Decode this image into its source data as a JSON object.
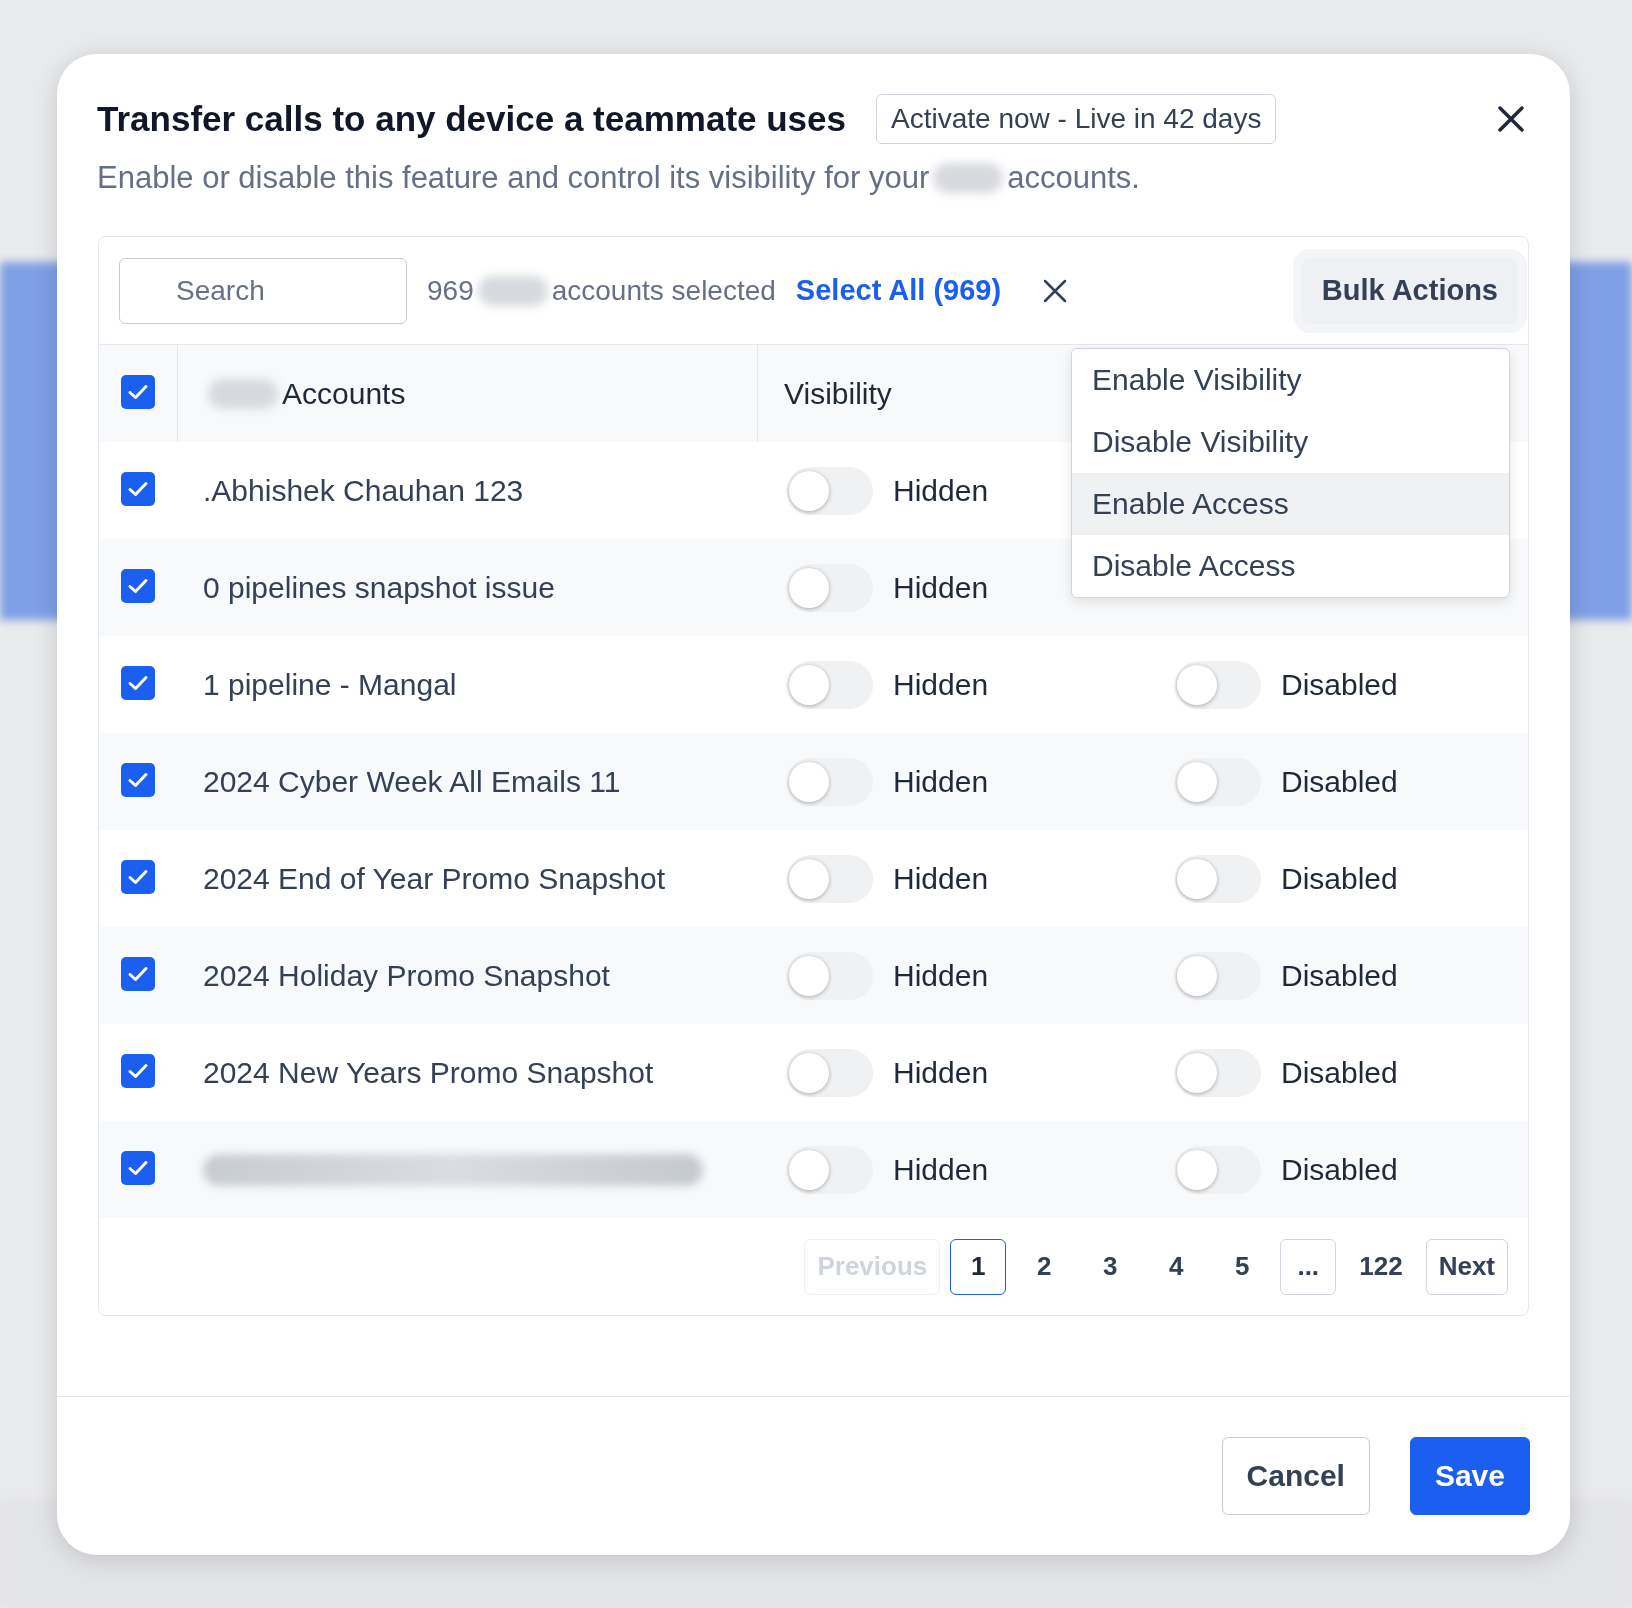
{
  "dialog": {
    "title": "Transfer calls to any device a teammate uses",
    "badge": "Activate now - Live in 42 days",
    "subtitle_before": "Enable or disable this feature and control its visibility for your",
    "subtitle_after": "accounts."
  },
  "toolbar": {
    "search": {
      "placeholder": "Search"
    },
    "count_before": "969",
    "count_after": "accounts selected",
    "select_all": "Select All (969)",
    "bulk_actions": "Bulk Actions"
  },
  "bulk_menu": {
    "open": true,
    "items": [
      {
        "label": "Enable Visibility",
        "highlighted": false
      },
      {
        "label": "Disable Visibility",
        "highlighted": false
      },
      {
        "label": "Enable Access",
        "highlighted": true
      },
      {
        "label": "Disable Access",
        "highlighted": false
      }
    ]
  },
  "table": {
    "all_checked": true,
    "columns": [
      "Accounts",
      "Visibility"
    ],
    "rows": [
      {
        "name": ".Abhishek Chauhan 123",
        "checked": true,
        "visibility": {
          "on": false,
          "label": "Hidden"
        }
      },
      {
        "name": "0 pipelines snapshot issue",
        "checked": true,
        "visibility": {
          "on": false,
          "label": "Hidden"
        }
      },
      {
        "name": "1 pipeline - Mangal",
        "checked": true,
        "visibility": {
          "on": false,
          "label": "Hidden"
        },
        "access": {
          "on": false,
          "label": "Disabled"
        }
      },
      {
        "name": "2024 Cyber Week All Emails 11",
        "checked": true,
        "visibility": {
          "on": false,
          "label": "Hidden"
        },
        "access": {
          "on": false,
          "label": "Disabled"
        }
      },
      {
        "name": "2024 End of Year Promo Snapshot",
        "checked": true,
        "visibility": {
          "on": false,
          "label": "Hidden"
        },
        "access": {
          "on": false,
          "label": "Disabled"
        }
      },
      {
        "name": "2024 Holiday Promo Snapshot",
        "checked": true,
        "visibility": {
          "on": false,
          "label": "Hidden"
        },
        "access": {
          "on": false,
          "label": "Disabled"
        }
      },
      {
        "name": "2024 New Years Promo Snapshot",
        "checked": true,
        "visibility": {
          "on": false,
          "label": "Hidden"
        },
        "access": {
          "on": false,
          "label": "Disabled"
        }
      },
      {
        "redacted": true,
        "checked": true,
        "visibility": {
          "on": false,
          "label": "Hidden"
        },
        "access": {
          "on": false,
          "label": "Disabled"
        }
      }
    ]
  },
  "pagination": {
    "previous": {
      "label": "Previous",
      "disabled": true
    },
    "pages": [
      {
        "label": "1",
        "kind": "page",
        "selected": true
      },
      {
        "label": "2",
        "kind": "page",
        "selected": false
      },
      {
        "label": "3",
        "kind": "page",
        "selected": false
      },
      {
        "label": "4",
        "kind": "page",
        "selected": false
      },
      {
        "label": "5",
        "kind": "page",
        "selected": false
      },
      {
        "label": "...",
        "kind": "more",
        "selected": false
      },
      {
        "label": "122",
        "kind": "page",
        "selected": false
      }
    ],
    "next": {
      "label": "Next",
      "disabled": false
    }
  },
  "footer": {
    "cancel": "Cancel",
    "save": "Save"
  }
}
